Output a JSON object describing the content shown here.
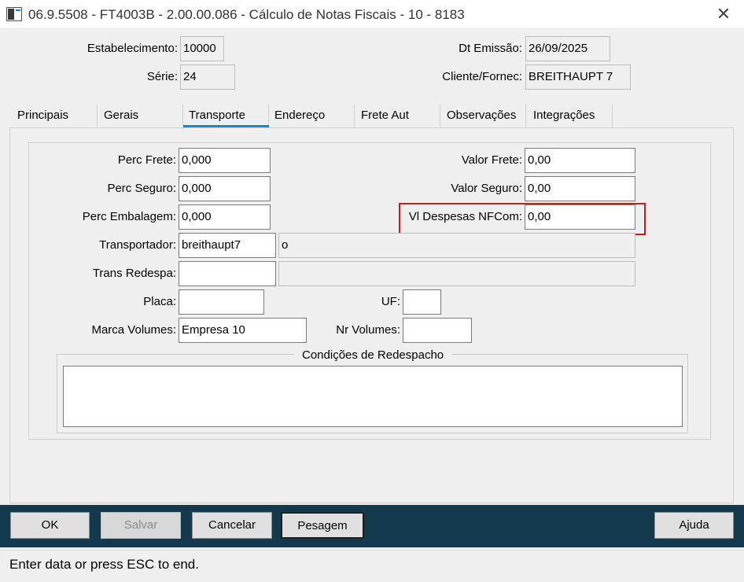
{
  "window": {
    "title": "06.9.5508 - FT4003B - 2.00.00.086 - Cálculo de Notas Fiscais - 10 - 8183",
    "app_icon": "window-app-icon",
    "close_icon": "close-icon",
    "close_glyph": "✕"
  },
  "header": {
    "estabelecimento_label": "Estabelecimento:",
    "estabelecimento_value": "10000",
    "serie_label": "Série:",
    "serie_value": "24",
    "dt_emissao_label": "Dt Emissão:",
    "dt_emissao_value": "26/09/2025",
    "cliente_label": "Cliente/Fornec:",
    "cliente_value": "BREITHAUPT 7"
  },
  "tabs": [
    {
      "label": "Principais"
    },
    {
      "label": "Gerais"
    },
    {
      "label": "Transporte",
      "active": true
    },
    {
      "label": "Endereço"
    },
    {
      "label": "Frete Aut"
    },
    {
      "label": "Observações"
    },
    {
      "label": "Integrações"
    }
  ],
  "transporte": {
    "perc_frete_label": "Perc Frete:",
    "perc_frete_value": "0,000",
    "perc_seguro_label": "Perc Seguro:",
    "perc_seguro_value": "0,000",
    "perc_embalagem_label": "Perc Embalagem:",
    "perc_embalagem_value": "0,000",
    "valor_frete_label": "Valor Frete:",
    "valor_frete_value": "0,00",
    "valor_seguro_label": "Valor Seguro:",
    "valor_seguro_value": "0,00",
    "vl_despesas_label": "Vl Despesas NFCom:",
    "vl_despesas_value": "0,00",
    "transportador_label": "Transportador:",
    "transportador_value": "breithaupt7",
    "transportador_desc": "o",
    "trans_redespa_label": "Trans Redespa:",
    "trans_redespa_value": "",
    "trans_redespa_desc": "",
    "placa_label": "Placa:",
    "placa_value": "",
    "uf_label": "UF:",
    "uf_value": "",
    "marca_volumes_label": "Marca Volumes:",
    "marca_volumes_value": "Empresa 10",
    "nr_volumes_label": "Nr Volumes:",
    "nr_volumes_value": "",
    "condicoes_title": "Condições de Redespacho",
    "condicoes_value": ""
  },
  "highlight_color": "#e01010",
  "accent_color": "#0b8ad6",
  "button_bar_color": "#13394d",
  "buttons": {
    "ok": "OK",
    "salvar": "Salvar",
    "cancelar": "Cancelar",
    "pesagem": "Pesagem",
    "ajuda": "Ajuda"
  },
  "status": {
    "text": "Enter data or press ESC to end."
  }
}
